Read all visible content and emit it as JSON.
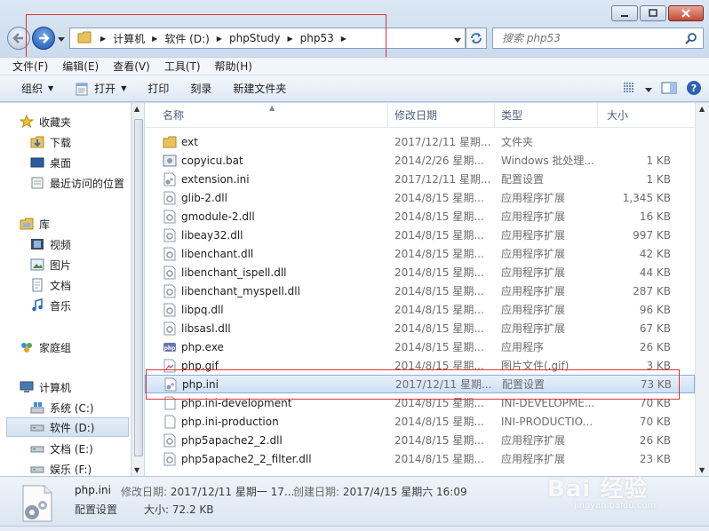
{
  "address": {
    "crumbs": [
      "计算机",
      "软件 (D:)",
      "phpStudy",
      "php53"
    ]
  },
  "search": {
    "placeholder": "搜索 php53"
  },
  "menu": [
    "文件(F)",
    "编辑(E)",
    "查看(V)",
    "工具(T)",
    "帮助(H)"
  ],
  "commands": {
    "organize": "组织",
    "open": "打开",
    "print": "打印",
    "burn": "刻录",
    "new_folder": "新建文件夹"
  },
  "nav": {
    "favorites": "收藏夹",
    "downloads": "下载",
    "desktop": "桌面",
    "recent": "最近访问的位置",
    "libraries": "库",
    "videos": "视频",
    "pictures": "图片",
    "documents": "文档",
    "music": "音乐",
    "homegroup": "家庭组",
    "computer": "计算机",
    "drive_c": "系统 (C:)",
    "drive_d": "软件 (D:)",
    "drive_e": "文档 (E:)",
    "drive_f": "娱乐 (F:)"
  },
  "columns": {
    "name": "名称",
    "date": "修改日期",
    "type": "类型",
    "size": "大小"
  },
  "files": [
    {
      "name": "ext",
      "date": "2017/12/11 星期...",
      "type": "文件夹",
      "size": "",
      "icon": "folder-icon"
    },
    {
      "name": "copyicu.bat",
      "date": "2014/2/26 星期...",
      "type": "Windows 批处理...",
      "size": "1 KB",
      "icon": "batch-file-icon"
    },
    {
      "name": "extension.ini",
      "date": "2017/12/11 星期...",
      "type": "配置设置",
      "size": "1 KB",
      "icon": "ini-file-icon"
    },
    {
      "name": "glib-2.dll",
      "date": "2014/8/15 星期...",
      "type": "应用程序扩展",
      "size": "1,345 KB",
      "icon": "dll-file-icon"
    },
    {
      "name": "gmodule-2.dll",
      "date": "2014/8/15 星期...",
      "type": "应用程序扩展",
      "size": "16 KB",
      "icon": "dll-file-icon"
    },
    {
      "name": "libeay32.dll",
      "date": "2014/8/15 星期...",
      "type": "应用程序扩展",
      "size": "997 KB",
      "icon": "dll-file-icon"
    },
    {
      "name": "libenchant.dll",
      "date": "2014/8/15 星期...",
      "type": "应用程序扩展",
      "size": "42 KB",
      "icon": "dll-file-icon"
    },
    {
      "name": "libenchant_ispell.dll",
      "date": "2014/8/15 星期...",
      "type": "应用程序扩展",
      "size": "44 KB",
      "icon": "dll-file-icon"
    },
    {
      "name": "libenchant_myspell.dll",
      "date": "2014/8/15 星期...",
      "type": "应用程序扩展",
      "size": "287 KB",
      "icon": "dll-file-icon"
    },
    {
      "name": "libpq.dll",
      "date": "2014/8/15 星期...",
      "type": "应用程序扩展",
      "size": "96 KB",
      "icon": "dll-file-icon"
    },
    {
      "name": "libsasl.dll",
      "date": "2014/8/15 星期...",
      "type": "应用程序扩展",
      "size": "67 KB",
      "icon": "dll-file-icon"
    },
    {
      "name": "php.exe",
      "date": "2014/8/15 星期...",
      "type": "应用程序",
      "size": "26 KB",
      "icon": "php-exe-icon"
    },
    {
      "name": "php.gif",
      "date": "2014/8/15 星期...",
      "type": "图片文件(.gif)",
      "size": "3 KB",
      "icon": "image-file-icon"
    },
    {
      "name": "php.ini",
      "date": "2017/12/11 星期...",
      "type": "配置设置",
      "size": "73 KB",
      "icon": "ini-file-icon",
      "selected": true
    },
    {
      "name": "php.ini-development",
      "date": "2014/8/15 星期...",
      "type": "INI-DEVELOPME...",
      "size": "70 KB",
      "icon": "blank-file-icon"
    },
    {
      "name": "php.ini-production",
      "date": "2014/8/15 星期...",
      "type": "INI-PRODUCTIO...",
      "size": "70 KB",
      "icon": "blank-file-icon"
    },
    {
      "name": "php5apache2_2.dll",
      "date": "2014/8/15 星期...",
      "type": "应用程序扩展",
      "size": "26 KB",
      "icon": "dll-file-icon"
    },
    {
      "name": "php5apache2_2_filter.dll",
      "date": "2014/8/15 星期...",
      "type": "应用程序扩展",
      "size": "23 KB",
      "icon": "dll-file-icon"
    }
  ],
  "details": {
    "name": "php.ini",
    "type": "配置设置",
    "modified_label": "修改日期:",
    "modified": "2017/12/11 星期一 17...",
    "created_label": "创建日期:",
    "created": "2017/4/15 星期六 16:09",
    "size_label": "大小:",
    "size": "72.2 KB"
  },
  "watermark": {
    "main": "Bai 经验",
    "sub": "jingyan.baidu.com"
  },
  "colors": {
    "highlight_box": "#e0312e",
    "selection": "#cee0f5"
  }
}
